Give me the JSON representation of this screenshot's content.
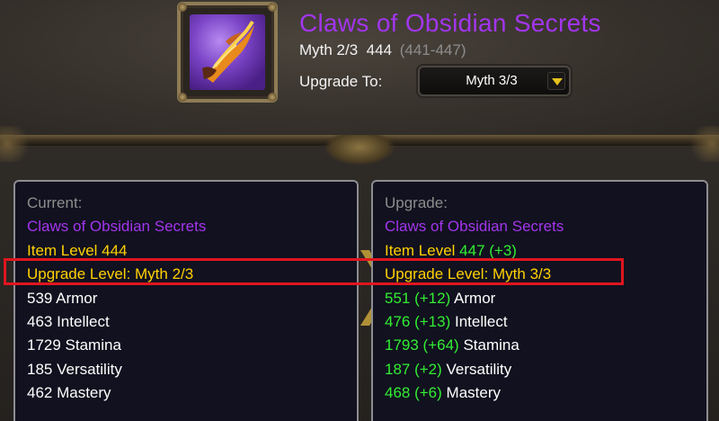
{
  "item": {
    "name": "Claws of Obsidian Secrets",
    "track": "Myth 2/3",
    "item_level": "444",
    "level_range": "(441-447)",
    "icon": "claw-weapon-icon"
  },
  "upgrade_to": {
    "label": "Upgrade To:",
    "selected": "Myth 3/3",
    "dropdown_icon": "chevron-down-icon"
  },
  "current": {
    "header": "Current:",
    "name": "Claws of Obsidian Secrets",
    "item_level": "Item Level 444",
    "upgrade_level": "Upgrade Level: Myth 2/3",
    "armor": "539 Armor",
    "intellect": "463 Intellect",
    "stamina": "1729 Stamina",
    "versatility": "185 Versatility",
    "mastery": "462 Mastery"
  },
  "upgrade": {
    "header": "Upgrade:",
    "name": "Claws of Obsidian Secrets",
    "item_level_label": "Item Level",
    "item_level_value": "447 (+3)",
    "upgrade_level": "Upgrade Level: Myth 3/3",
    "armor_value": "551 (+12)",
    "armor_label": "Armor",
    "intellect_value": "476 (+13)",
    "intellect_label": "Intellect",
    "stamina_value": "1793 (+64)",
    "stamina_label": "Stamina",
    "versatility_value": "187 (+2)",
    "versatility_label": "Versatility",
    "mastery_value": "468 (+6)",
    "mastery_label": "Mastery"
  },
  "colors": {
    "epic_purple": "#a335ee",
    "gold_yellow": "#ffd100",
    "upgrade_green": "#33ee33",
    "highlight_red": "#e0161e"
  }
}
